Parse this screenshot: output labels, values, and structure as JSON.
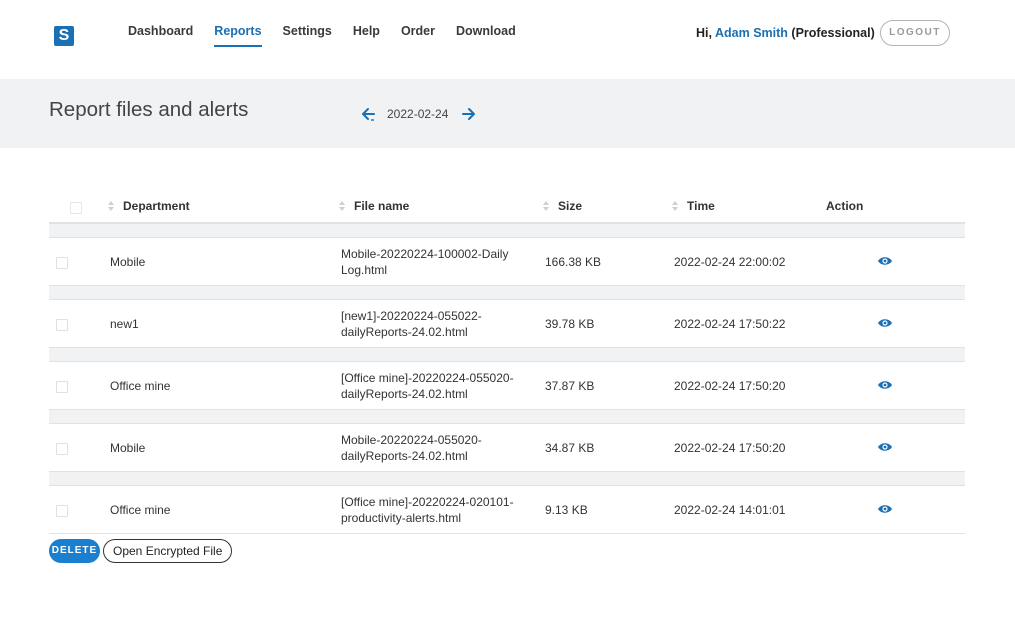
{
  "nav": {
    "logo_letter": "S",
    "items": [
      {
        "label": "Dashboard",
        "active": false
      },
      {
        "label": "Reports",
        "active": true
      },
      {
        "label": "Settings",
        "active": false
      },
      {
        "label": "Help",
        "active": false
      },
      {
        "label": "Order",
        "active": false
      },
      {
        "label": "Download",
        "active": false
      }
    ]
  },
  "user": {
    "greeting": "Hi,",
    "name": "Adam Smith",
    "plan": "(Professional)",
    "logout_label": "LOGOUT"
  },
  "header": {
    "title": "Report files and alerts",
    "date": "2022-02-24"
  },
  "table": {
    "columns": {
      "department": "Department",
      "file_name": "File name",
      "size": "Size",
      "time": "Time",
      "action": "Action"
    },
    "rows": [
      {
        "department": "Mobile",
        "file_name": "Mobile-20220224-100002-Daily Log.html",
        "size": "166.38 KB",
        "time": "2022-02-24 22:00:02"
      },
      {
        "department": "new1",
        "file_name": "[new1]-20220224-055022-dailyReports-24.02.html",
        "size": "39.78 KB",
        "time": "2022-02-24 17:50:22"
      },
      {
        "department": "Office mine",
        "file_name": "[Office mine]-20220224-055020-dailyReports-24.02.html",
        "size": "37.87 KB",
        "time": "2022-02-24 17:50:20"
      },
      {
        "department": "Mobile",
        "file_name": "Mobile-20220224-055020-dailyReports-24.02.html",
        "size": "34.87 KB",
        "time": "2022-02-24 17:50:20"
      },
      {
        "department": "Office mine",
        "file_name": "[Office mine]-20220224-020101-productivity-alerts.html",
        "size": "9.13 KB",
        "time": "2022-02-24 14:01:01"
      }
    ]
  },
  "buttons": {
    "delete_label": "DELETE",
    "open_encrypted_label": "Open Encrypted File"
  },
  "colors": {
    "accent": "#1b6fb3",
    "delete_button": "#1b7fd0",
    "band_background": "#f1f2f4"
  },
  "icons": {
    "prev_date": "arrow-left-icon",
    "next_date": "arrow-right-icon",
    "view": "eye-icon",
    "sort": "sort-icon"
  }
}
